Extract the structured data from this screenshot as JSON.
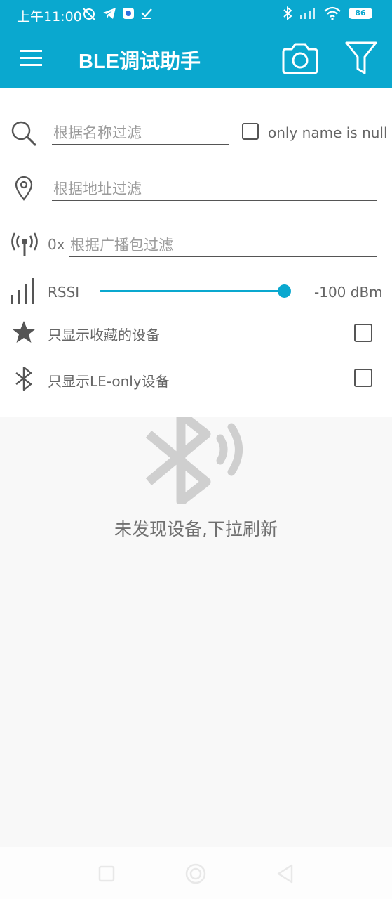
{
  "status_bar": {
    "time": "上午11:00",
    "battery": "86",
    "color": "#0aa8cf"
  },
  "app_bar": {
    "title": "BLE调试助手",
    "icons": [
      "menu-icon",
      "camera-icon",
      "filter-icon"
    ]
  },
  "filters": {
    "name_filter_placeholder": "根据名称过滤",
    "only_name_null_label": "only name is null",
    "address_filter_placeholder": "根据地址过滤",
    "adv_prefix": "0x",
    "adv_filter_placeholder": "根据广播包过滤",
    "rssi_label": "RSSI",
    "rssi_value": "-100 dBm",
    "rssi_fraction": 1.0,
    "favorites_label": "只显示收藏的设备",
    "le_only_label": "只显示LE-only设备"
  },
  "empty_state": {
    "message": "未发现设备,下拉刷新"
  }
}
